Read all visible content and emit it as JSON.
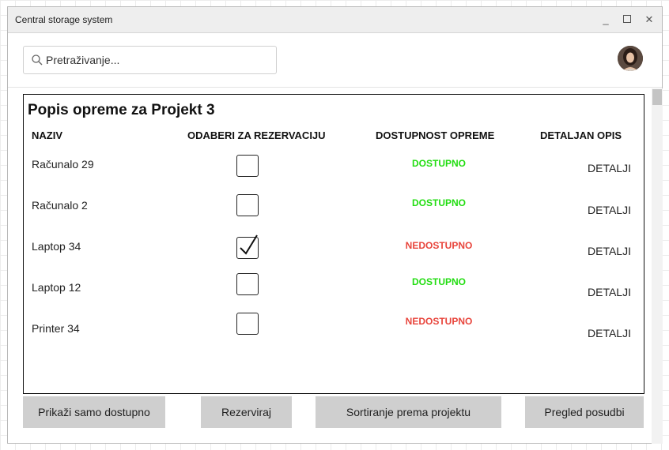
{
  "window": {
    "title": "Central storage system"
  },
  "search": {
    "placeholder": "Pretraživanje..."
  },
  "panel": {
    "title": "Popis opreme za Projekt 3",
    "columns": {
      "name": "NAZIV",
      "select": "ODABERI ZA REZERVACIJU",
      "availability": "DOSTUPNOST OPREME",
      "description": "DETALJAN OPIS"
    },
    "rows": [
      {
        "name": "Računalo 29",
        "checked": false,
        "status": "DOSTUPNO",
        "detail": "DETALJI"
      },
      {
        "name": "Računalo 2",
        "checked": false,
        "status": "DOSTUPNO",
        "detail": "DETALJI"
      },
      {
        "name": "Laptop 34",
        "checked": true,
        "status": "NEDOSTUPNO",
        "detail": "DETALJI"
      },
      {
        "name": "Laptop 12",
        "checked": false,
        "status": "DOSTUPNO",
        "detail": "DETALJI"
      },
      {
        "name": "Printer 34",
        "checked": false,
        "status": "NEDOSTUPNO",
        "detail": "DETALJI"
      }
    ]
  },
  "buttons": {
    "show_available": "Prikaži samo dostupno",
    "reserve": "Rezerviraj",
    "sort_by_project": "Sortiranje prema projektu",
    "loans_overview": "Pregled posudbi"
  },
  "icons": {
    "search": "search-icon",
    "minimize": "minimize-icon",
    "maximize": "maximize-icon",
    "close": "close-icon",
    "check": "checkmark-icon"
  },
  "colors": {
    "available": "#22dd11",
    "unavailable": "#e8453c",
    "button_bg": "#cfcfcf"
  }
}
